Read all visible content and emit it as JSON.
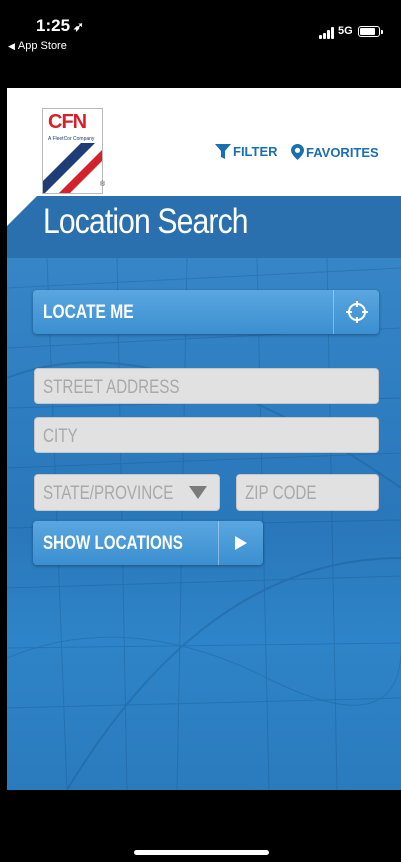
{
  "status_bar": {
    "time": "1:25",
    "back_label": "App Store",
    "network": "5G"
  },
  "header": {
    "logo_text": "CFN",
    "logo_sub": "A FleetCor Company",
    "logo_reg": "®",
    "filter_label": "FILTER",
    "favorites_label": "FAVORITES"
  },
  "main": {
    "title": "Location Search",
    "locate_me_label": "LOCATE ME",
    "street_placeholder": "STREET ADDRESS",
    "city_placeholder": "CITY",
    "state_placeholder": "STATE/PROVINCE",
    "zip_placeholder": "ZIP CODE",
    "show_locations_label": "SHOW LOCATIONS"
  },
  "colors": {
    "brand_red": "#d4212b",
    "brand_navy": "#1e3c78",
    "link_blue": "#1a6fb0",
    "panel_blue": "#2f7fc2",
    "title_band": "#2a6fae"
  }
}
